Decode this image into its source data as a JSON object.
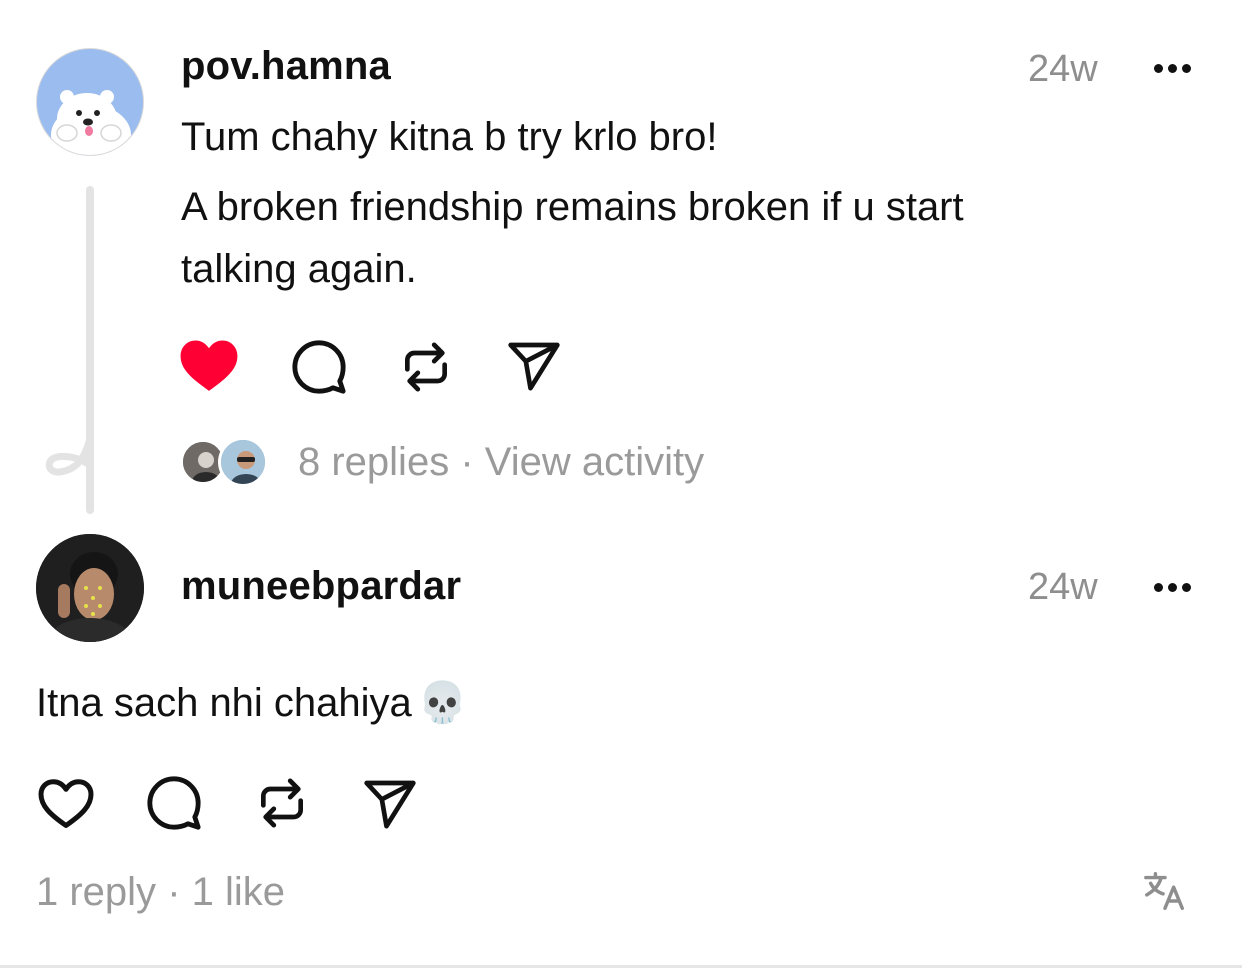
{
  "post": {
    "username": "pov.hamna",
    "time": "24w",
    "lines": [
      "Tum chahy kitna b try krlo bro!",
      "A broken friendship remains broken if u start",
      "talking again."
    ],
    "liked": true,
    "replies_text": "8 replies",
    "separator": "·",
    "activity_text": "View activity",
    "avatar_icon": "polar-bear-avatar"
  },
  "reply": {
    "username": "muneebpardar",
    "time": "24w",
    "text": "Itna sach nhi chahiya",
    "emoji": "💀",
    "liked": false,
    "replies_text": "1 reply",
    "separator": "·",
    "likes_text": "1 like"
  },
  "colors": {
    "like_active": "#ff0034",
    "muted": "#9a9a9a",
    "avatar_bg": "#9bbcef"
  }
}
